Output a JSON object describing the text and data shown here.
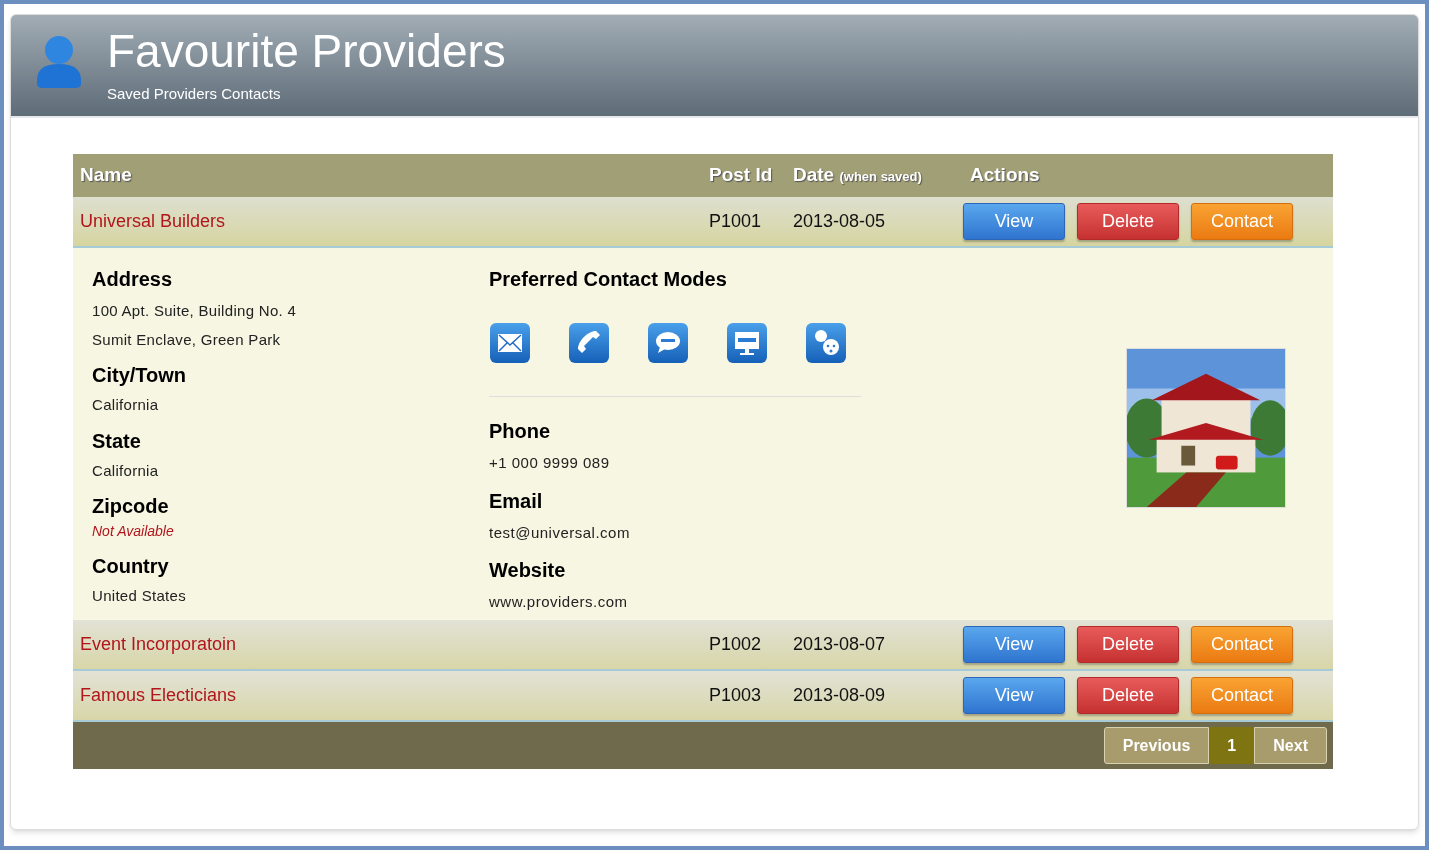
{
  "header": {
    "title": "Favourite Providers",
    "subtitle": "Saved Providers Contacts"
  },
  "table": {
    "columns": [
      {
        "label": "Name"
      },
      {
        "label": "Post Id"
      },
      {
        "label": "Date",
        "note": "(when saved)"
      },
      {
        "label": "Actions"
      }
    ],
    "rows": [
      {
        "name": "Universal Builders",
        "post_id": "P1001",
        "date": "2013-08-05",
        "expanded": true,
        "actions": [
          "View",
          "Delete",
          "Contact"
        ],
        "details": {
          "address_label": "Address",
          "address_lines": [
            "100 Apt. Suite, Building No. 4",
            "Sumit Enclave, Green Park"
          ],
          "fields": [
            {
              "label": "City/Town",
              "value": "California",
              "available": true
            },
            {
              "label": "State",
              "value": "California",
              "available": true
            },
            {
              "label": "Zipcode",
              "value": "Not Available",
              "available": false
            },
            {
              "label": "Country",
              "value": "United States",
              "available": true
            }
          ],
          "modes_label": "Preferred Contact Modes",
          "modes": [
            {
              "kind": "email"
            },
            {
              "kind": "phone"
            },
            {
              "kind": "sms"
            },
            {
              "kind": "desktop"
            },
            {
              "kind": "chat"
            }
          ],
          "contacts": [
            {
              "label": "Phone",
              "value": "+1 000 9999 089"
            },
            {
              "label": "Email",
              "value": "test@universal.com"
            },
            {
              "label": "Website",
              "value": "www.providers.com"
            }
          ],
          "photo": {
            "kind": "picture"
          }
        }
      },
      {
        "name": "Event Incorporatoin",
        "post_id": "P1002",
        "date": "2013-08-07",
        "expanded": false,
        "actions": [
          "View",
          "Delete",
          "Contact"
        ]
      },
      {
        "name": "Famous Electicians",
        "post_id": "P1003",
        "date": "2013-08-09",
        "expanded": false,
        "actions": [
          "View",
          "Delete",
          "Contact"
        ]
      }
    ]
  },
  "pagination": {
    "previous": "Previous",
    "pages": [
      {
        "label": "1",
        "selected": true
      }
    ],
    "next": "Next"
  }
}
